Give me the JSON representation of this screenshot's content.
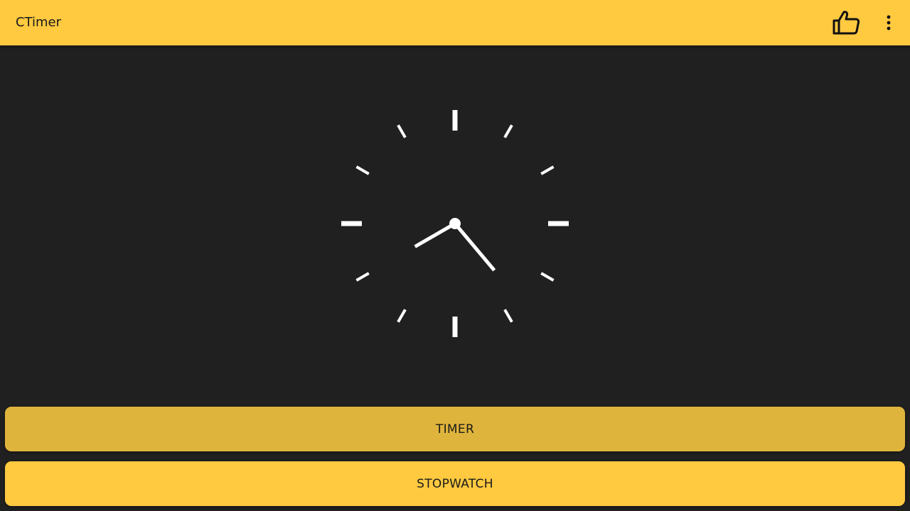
{
  "app": {
    "title": "CTimer"
  },
  "toolbar": {
    "rate_icon": "thumb-up-icon",
    "menu_icon": "more-vert-icon"
  },
  "clock": {
    "hour": 4,
    "minute": 40
  },
  "buttons": {
    "timer_label": "TIMER",
    "stopwatch_label": "STOPWATCH"
  },
  "colors": {
    "accent": "#ffc940",
    "accent_pressed": "#dfb43c",
    "background": "#202020",
    "clock_face": "#ffffff"
  }
}
